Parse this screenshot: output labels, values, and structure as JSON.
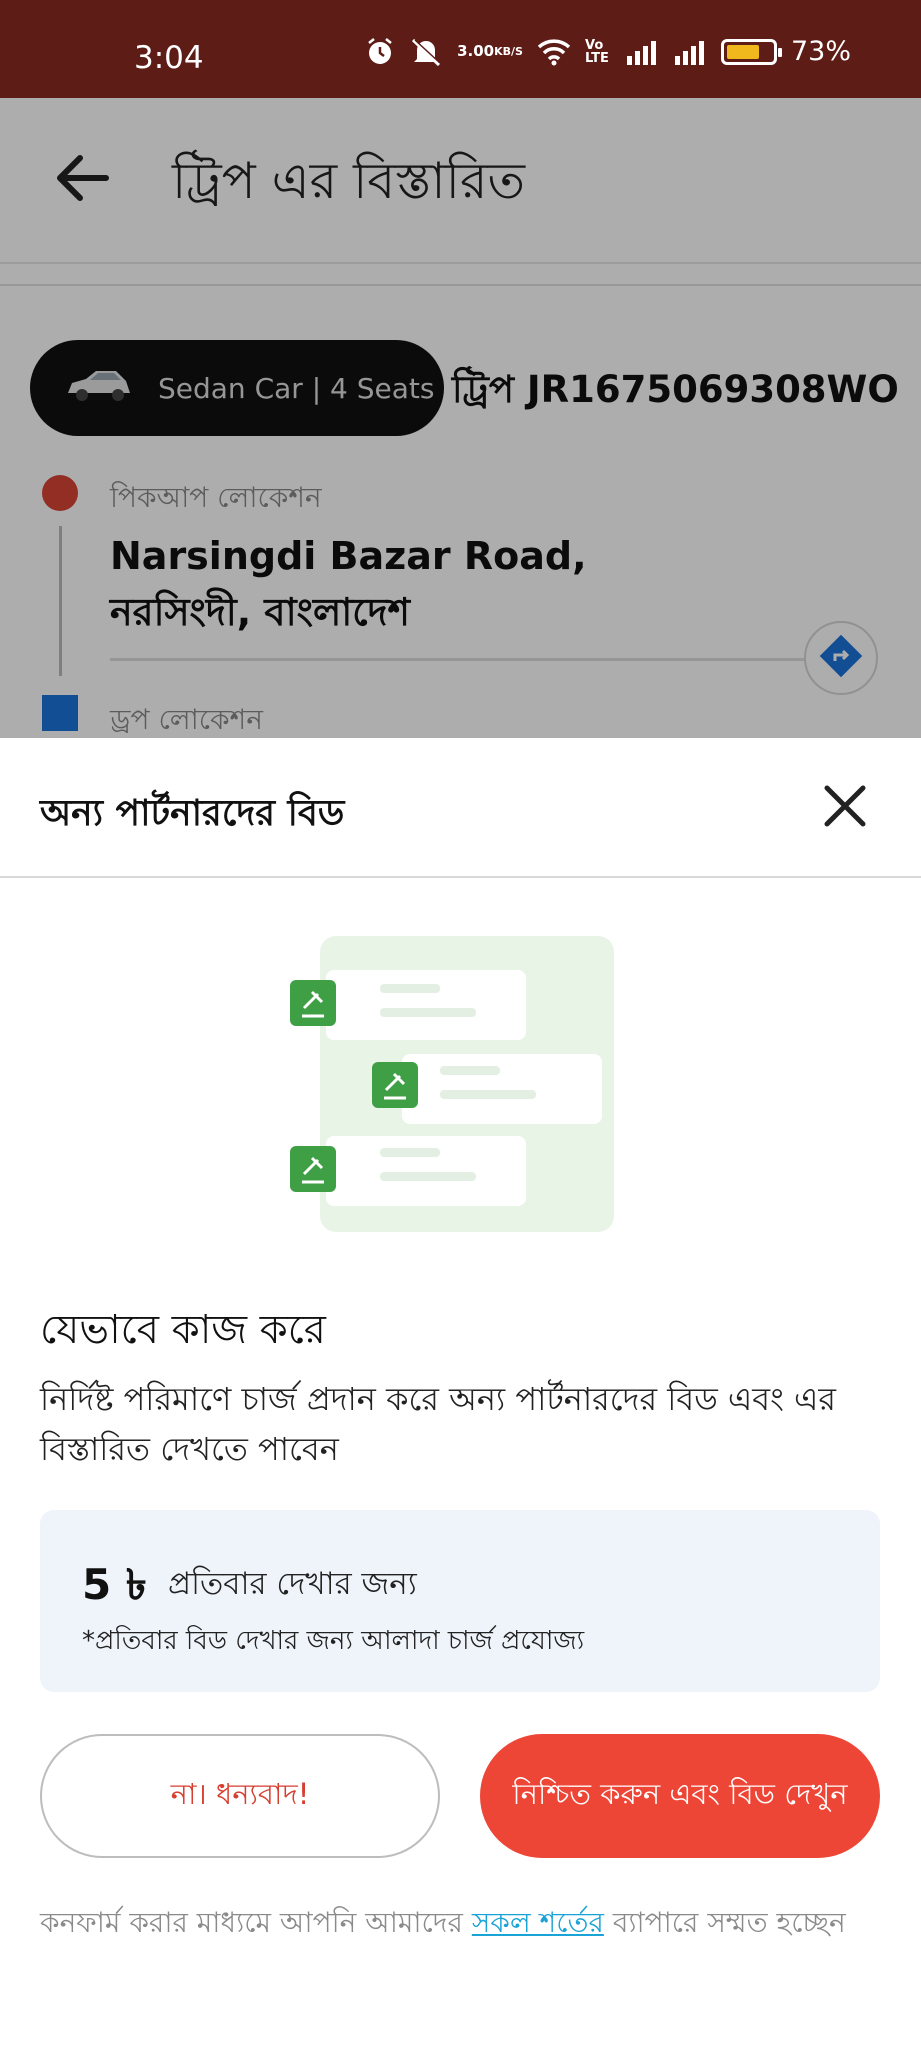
{
  "status_bar": {
    "time": "3:04",
    "net_speed_value": "3.00",
    "net_speed_unit": "KB/S",
    "volte": "Vo LTE",
    "battery_text": "73%",
    "battery_level": 0.73,
    "icons": [
      "alarm-icon",
      "mute-icon",
      "wifi-icon",
      "signal-icon",
      "signal-icon",
      "battery-icon"
    ]
  },
  "trip_page": {
    "title": "ট্রিপ এর বিস্তারিত",
    "vehicle": "Sedan Car | 4 Seats",
    "trip_id": "ট্রিপ JR1675069308WO",
    "pickup_label": "পিকআপ লোকেশন",
    "pickup_address": "Narsingdi Bazar Road, নরসিংদী, বাংলাদেশ",
    "drop_label": "ড্রপ লোকেশন"
  },
  "sheet": {
    "title": "অন্য পার্টনারদের বিড",
    "how_title": "যেভাবে কাজ করে",
    "how_desc": "নির্দিষ্ট পরিমাণে চার্জ প্রদান করে অন্য পার্টনারদের বিড এবং এর বিস্তারিত দেখতে পাবেন",
    "price_amount": "5 ৳",
    "price_per": "প্রতিবার দেখার জন্য",
    "price_note": "*প্রতিবার বিড দেখার জন্য আলাদা চার্জ প্রযোজ্য",
    "no_button": "না। ধন্যবাদ!",
    "confirm_button": "নিশ্চিত করুন এবং বিড দেখুন",
    "terms_prefix": "কনফার্ম করার মাধ্যমে আপনি আমাদের",
    "terms_link": "সকল শর্তের",
    "terms_suffix": "ব্যাপারে সম্মত হচ্ছেন"
  },
  "colors": {
    "status_bar": "#5e1c17",
    "accent_red": "#ee4636",
    "pickup": "#d94436",
    "drop": "#1a73d9",
    "link": "#1aa3d6",
    "price_card_bg": "#eef4fa",
    "illustration_green": "#3f9f45"
  }
}
